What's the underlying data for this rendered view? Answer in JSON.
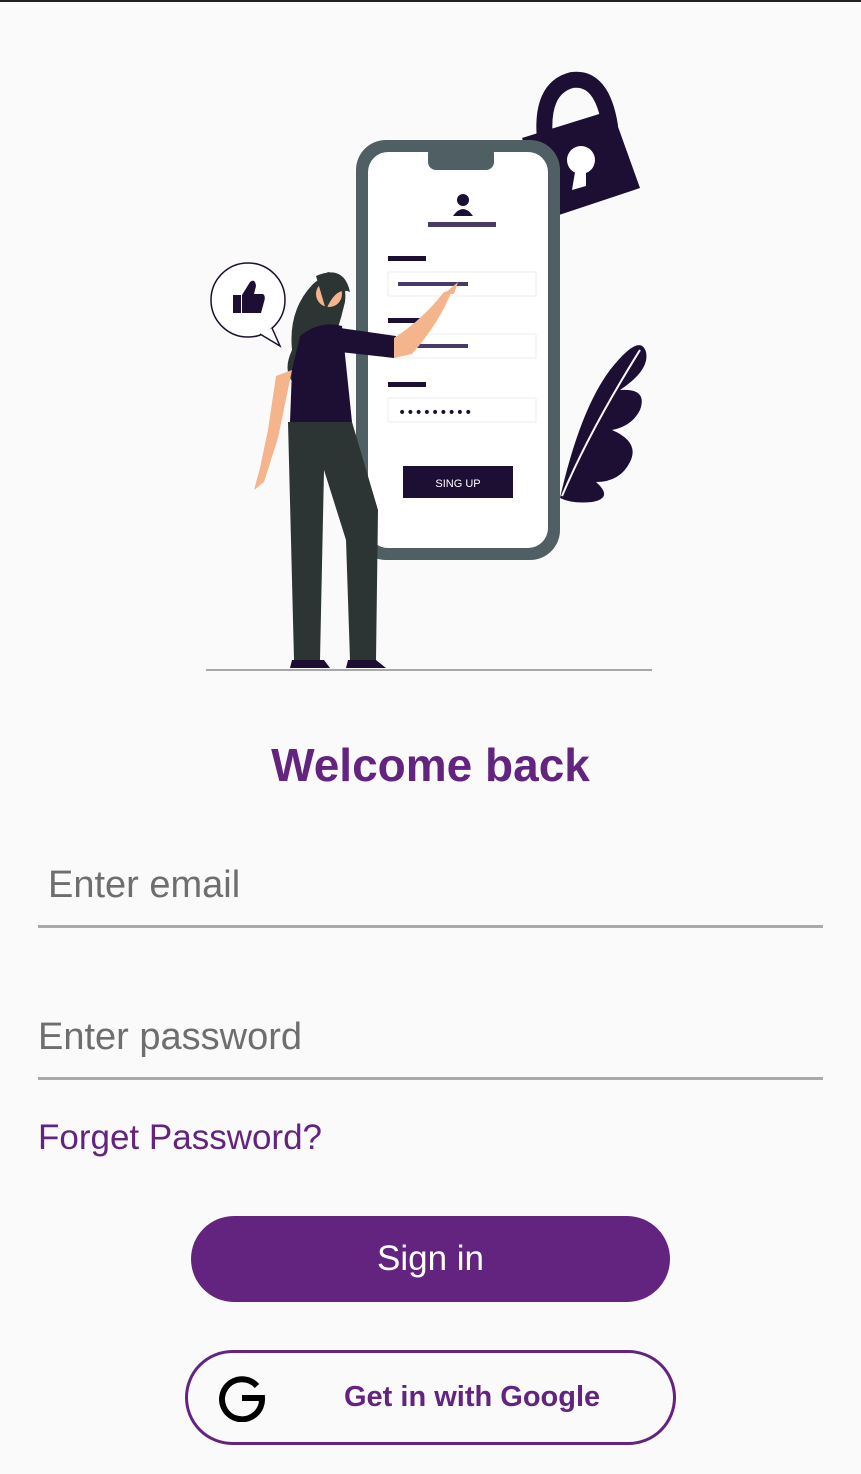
{
  "illustration": {
    "signup_button_label": "SING UP",
    "password_dots": "•••••••••"
  },
  "title": "Welcome back",
  "email": {
    "placeholder": "Enter email",
    "value": ""
  },
  "password": {
    "placeholder": "Enter password",
    "value": ""
  },
  "forget_password_label": "Forget Password?",
  "signin_label": "Sign in",
  "google_label": "Get in with Google",
  "colors": {
    "accent": "#62247f",
    "background": "#fafafa",
    "field_underline": "#a9a9a9",
    "illustration_dark": "#1d0f33",
    "illustration_phone": "#4f5f63"
  },
  "icons": [
    "lock-icon",
    "thumbs-up-icon",
    "user-icon",
    "google-icon"
  ]
}
